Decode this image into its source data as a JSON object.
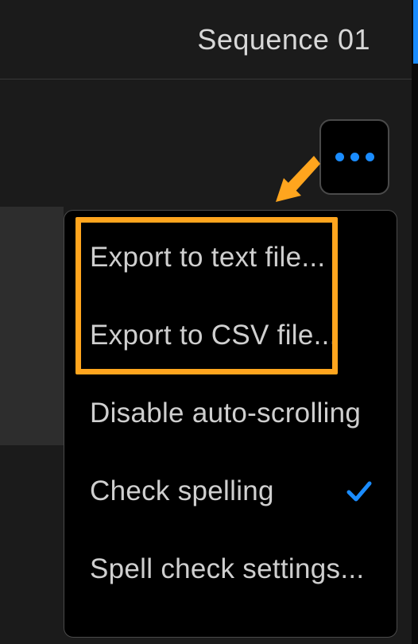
{
  "header": {
    "title": "Sequence 01"
  },
  "colors": {
    "accent": "#1a8cff",
    "highlight": "#ffa51e"
  },
  "menu": {
    "items": [
      {
        "label": "Export to text file...",
        "checked": false
      },
      {
        "label": "Export to CSV file...",
        "checked": false
      },
      {
        "label": "Disable auto-scrolling",
        "checked": false
      },
      {
        "label": "Check spelling",
        "checked": true
      },
      {
        "label": "Spell check settings...",
        "checked": false
      }
    ]
  },
  "annotation": {
    "arrow": true,
    "highlightFirstTwo": true
  }
}
